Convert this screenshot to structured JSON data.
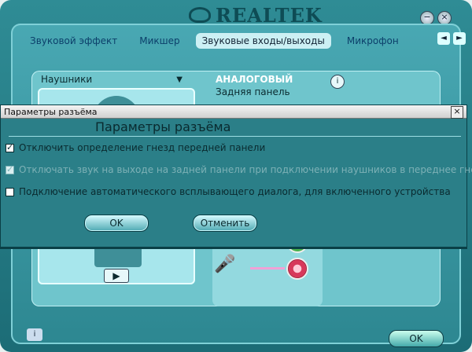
{
  "app": {
    "logo_text": "REALTEK"
  },
  "window_buttons": {
    "minimize": "−",
    "close": "×"
  },
  "tabs": [
    {
      "label": "Звуковой эффект"
    },
    {
      "label": "Микшер"
    },
    {
      "label": "Звуковые входы/выходы",
      "active": true
    },
    {
      "label": "Микрофон"
    }
  ],
  "tab_nav": {
    "left": "◄",
    "right": "►"
  },
  "panel": {
    "device": "Наушники",
    "analog_title": "АНАЛОГОВЫЙ",
    "back_panel": "Задняя панель",
    "play_symbol": "▶",
    "info_symbol": "i"
  },
  "bottom": {
    "ok_label": "OK",
    "info_symbol": "i"
  },
  "dialog": {
    "title": "Параметры разъёма",
    "headline": "Параметры разъёма",
    "close_symbol": "×",
    "options": [
      {
        "label": "Отключить определение гнезд передней панели",
        "checked": true,
        "disabled": false
      },
      {
        "label": "Отключать звук на выходе на задней панели при подключении наушников в переднее гнездо",
        "checked": true,
        "disabled": true
      },
      {
        "label": "Подключение автоматического всплывающего диалога, для включенного устройства",
        "checked": false,
        "disabled": false
      }
    ],
    "ok_label": "OK",
    "cancel_label": "Отменить"
  },
  "colors": {
    "frame": "#1c6c76",
    "panel": "#6fc5cc",
    "dialog": "#2b7f88",
    "accent_pink": "#d7385b",
    "accent_green": "#48b04e"
  }
}
